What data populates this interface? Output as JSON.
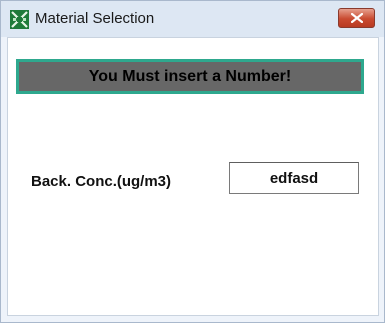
{
  "window": {
    "title": "Material Selection",
    "app_icon": "app-icon",
    "close_icon": "close-icon"
  },
  "banner": {
    "message": "You Must insert a Number!",
    "background_color": "#676767",
    "border_color": "#2ea88e"
  },
  "field": {
    "label": "Back. Conc.(ug/m3)",
    "value": "edfasd"
  }
}
